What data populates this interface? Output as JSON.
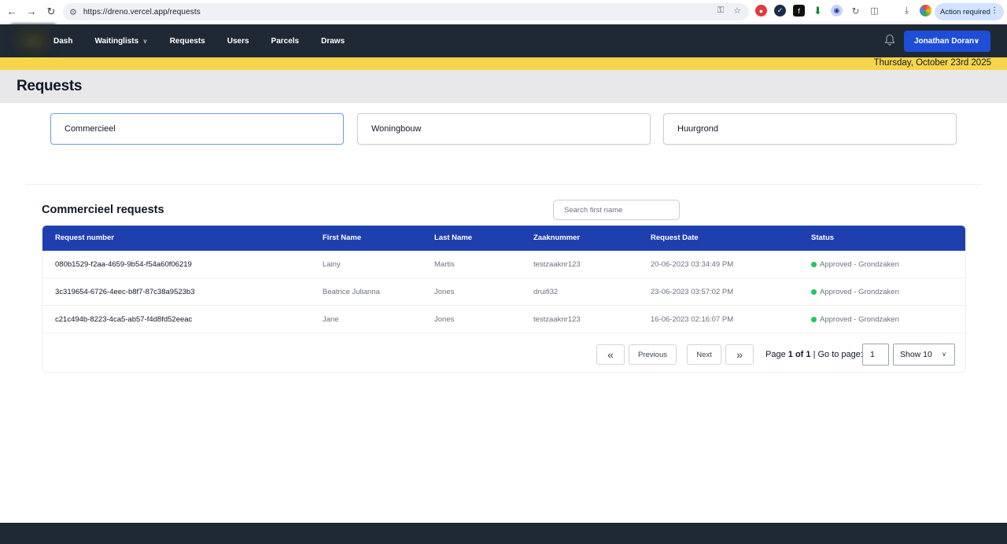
{
  "browser": {
    "url": "https://dreno.vercel.app/requests",
    "action_required": "Action required"
  },
  "nav": {
    "items": [
      {
        "label": "Dash"
      },
      {
        "label": "Waitinglists",
        "has_dropdown": true
      },
      {
        "label": "Requests"
      },
      {
        "label": "Users"
      },
      {
        "label": "Parcels"
      },
      {
        "label": "Draws"
      }
    ],
    "user_name": "Jonathan Doran"
  },
  "date_banner": "Thursday, October 23rd 2025",
  "page_title": "Requests",
  "tiles": [
    {
      "label": "Commercieel",
      "active": true
    },
    {
      "label": "Woningbouw",
      "active": false
    },
    {
      "label": "Huurgrond",
      "active": false
    }
  ],
  "section_title": "Commercieel requests",
  "search": {
    "placeholder": "Search first name",
    "value": ""
  },
  "table": {
    "columns": [
      "Request number",
      "First Name",
      "Last Name",
      "Zaaknummer",
      "Request Date",
      "Status"
    ],
    "rows": [
      {
        "request_number": "080b1529-f2aa-4659-9b54-f54a60f06219",
        "first_name": "Lainy",
        "last_name": "Martis",
        "zaaknummer": "testzaaknr123",
        "request_date": "20-06-2023 03:34:49 PM",
        "status": "Approved - Grondzaken"
      },
      {
        "request_number": "3c319654-6726-4eec-b8f7-87c38a9523b3",
        "first_name": "Beatrice Julianna",
        "last_name": "Jones",
        "zaaknummer": "druifi32",
        "request_date": "23-06-2023 03:57:02 PM",
        "status": "Approved - Grondzaken"
      },
      {
        "request_number": "c21c494b-8223-4ca5-ab57-f4d8fd52eeac",
        "first_name": "Jane",
        "last_name": "Jones",
        "zaaknummer": "testzaaknr123",
        "request_date": "16-06-2023 02:16:07 PM",
        "status": "Approved - Grondzaken"
      }
    ]
  },
  "pagination": {
    "first_label": "«",
    "previous_label": "Previous",
    "next_label": "Next",
    "last_label": "»",
    "page_word": "Page",
    "page_of": "1 of 1",
    "go_to_label": "| Go to page:",
    "page_input": "1",
    "show_label": "Show 10"
  },
  "colors": {
    "navbar": "#1f2933",
    "accent": "#1e4ed8",
    "table_header": "#1e40af",
    "date_banner": "#f7d54a",
    "status_approved": "#22c55e"
  }
}
